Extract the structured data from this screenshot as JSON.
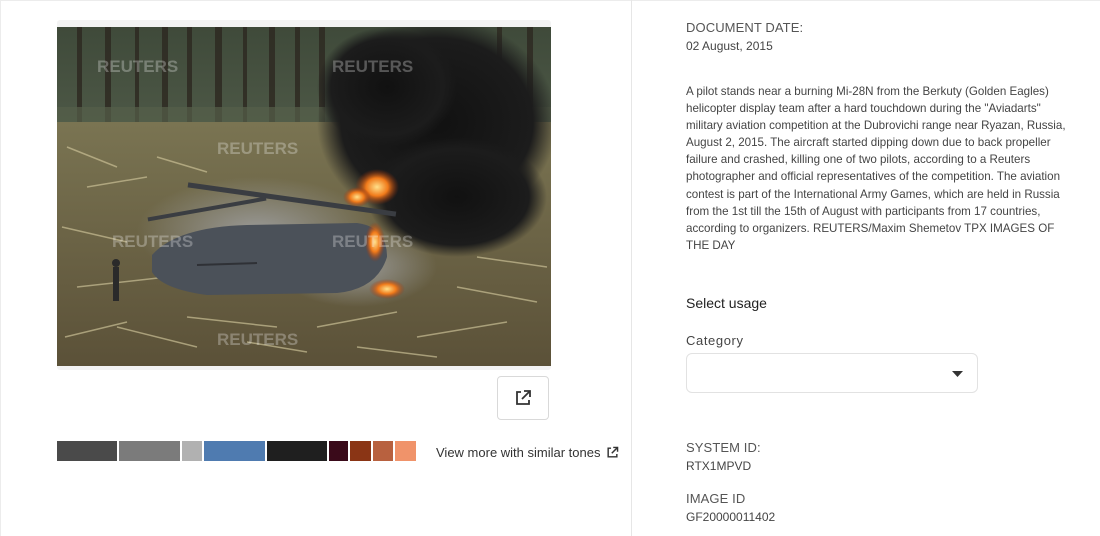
{
  "image": {
    "watermark": "REUTERS",
    "open_external_icon": "external-link-icon"
  },
  "tones": {
    "swatches": [
      "#4a4a4a",
      "#7b7b7b",
      "#b1b1b1",
      "#4f7bb0",
      "#1f1f1f",
      "#3a0a1a",
      "#8a3515",
      "#b8613f",
      "#f0936a"
    ],
    "link_label": "View more with similar tones",
    "link_icon": "external-link-icon"
  },
  "details": {
    "document_date_label": "DOCUMENT DATE:",
    "document_date_value": "02 August, 2015",
    "caption": "A pilot stands near a burning Mi-28N from the Berkuty (Golden Eagles) helicopter display team after a hard touchdown during the \"Aviadarts\" military aviation competition at the Dubrovichi range near Ryazan, Russia, August 2, 2015. The aircraft started dipping down due to back propeller failure and crashed, killing one of two pilots, according to a Reuters photographer and official representatives of the competition. The aviation contest is part of the International Army Games, which are held in Russia from the 1st till the 15th of August with participants from 17 countries, according to organizers. REUTERS/Maxim Shemetov TPX IMAGES OF THE DAY",
    "select_usage_title": "Select usage",
    "category_label": "Category",
    "category_value": "",
    "system_id_label": "SYSTEM ID:",
    "system_id_value": "RTX1MPVD",
    "image_id_label": "IMAGE ID",
    "image_id_value": "GF20000011402"
  }
}
